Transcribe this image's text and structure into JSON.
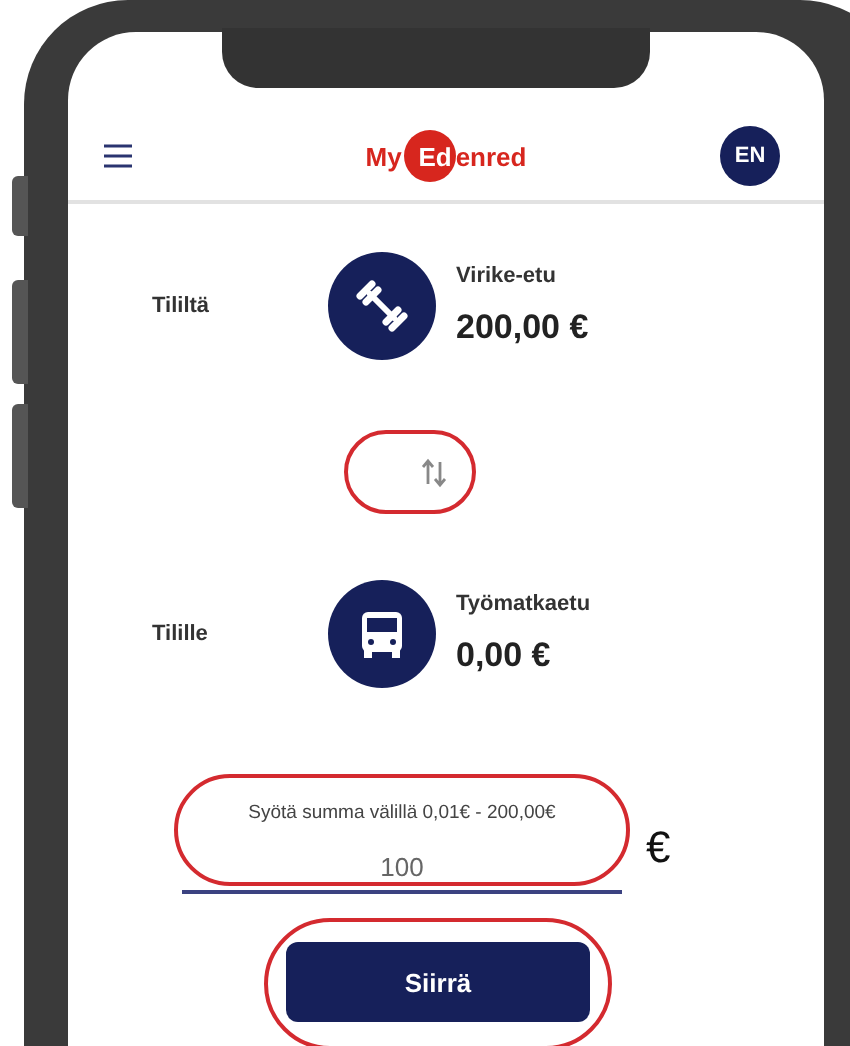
{
  "header": {
    "logo": {
      "prefix": "My",
      "badge": "Ed",
      "suffix": "enred"
    },
    "language": "EN"
  },
  "transfer": {
    "from": {
      "label": "Tililtä",
      "kind": "fitness",
      "name": "Virike-etu",
      "amount": "200,00 €"
    },
    "swap": {
      "highlighted": true
    },
    "to": {
      "label": "Tilille",
      "kind": "bus",
      "name": "Työmatkaetu",
      "amount": "0,00 €"
    }
  },
  "amount_field": {
    "label": "Syötä summa välillä 0,01€ - 200,00€",
    "value": "100",
    "currency": "€",
    "highlighted": true
  },
  "submit": {
    "label": "Siirrä",
    "highlighted": true
  }
}
